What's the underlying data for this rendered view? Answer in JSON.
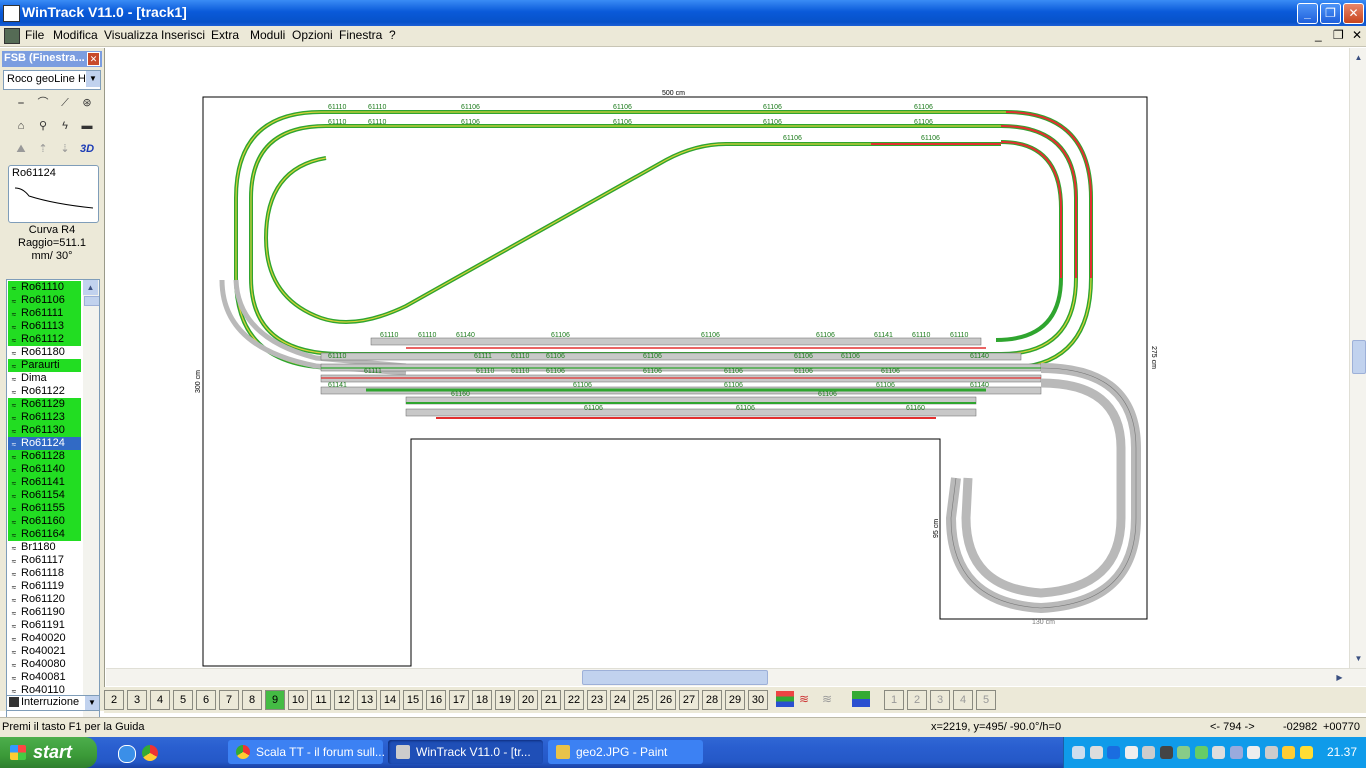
{
  "window": {
    "title": "WinTrack  V11.0 - [track1]",
    "controls": {
      "minimize": "_",
      "maximize": "❐",
      "close": "✕"
    }
  },
  "menu": [
    "File",
    "Modifica",
    "Visualizza",
    "Inserisci",
    "Extra",
    "Moduli",
    "Opzioni",
    "Finestra",
    "?"
  ],
  "mdi_controls": [
    "_",
    "❐",
    "✕"
  ],
  "fsb": {
    "title": "FSB (Finestra...",
    "library": "Roco geoLine H",
    "preview_code": "Ro61124",
    "description": [
      "Curva R4",
      "Raggio=511.1",
      "mm/ 30°"
    ],
    "parts": [
      {
        "label": "Ro61110",
        "hl": "g"
      },
      {
        "label": "Ro61106",
        "hl": "g"
      },
      {
        "label": "Ro61111",
        "hl": "g"
      },
      {
        "label": "Ro61113",
        "hl": "g"
      },
      {
        "label": "Ro61112",
        "hl": "g"
      },
      {
        "label": "Ro61180",
        "hl": ""
      },
      {
        "label": "Paraurti",
        "hl": "g"
      },
      {
        "label": "Dima",
        "hl": ""
      },
      {
        "label": "Ro61122",
        "hl": ""
      },
      {
        "label": "Ro61129",
        "hl": "g"
      },
      {
        "label": "Ro61123",
        "hl": "g"
      },
      {
        "label": "Ro61130",
        "hl": "g"
      },
      {
        "label": "Ro61124",
        "hl": "sel"
      },
      {
        "label": "Ro61128",
        "hl": "g"
      },
      {
        "label": "Ro61140",
        "hl": "g"
      },
      {
        "label": "Ro61141",
        "hl": "g"
      },
      {
        "label": "Ro61154",
        "hl": "g"
      },
      {
        "label": "Ro61155",
        "hl": "g"
      },
      {
        "label": "Ro61160",
        "hl": "g"
      },
      {
        "label": "Ro61164",
        "hl": "g"
      },
      {
        "label": "Br1180",
        "hl": ""
      },
      {
        "label": "Ro61117",
        "hl": ""
      },
      {
        "label": "Ro61118",
        "hl": ""
      },
      {
        "label": "Ro61119",
        "hl": ""
      },
      {
        "label": "Ro61120",
        "hl": ""
      },
      {
        "label": "Ro61190",
        "hl": ""
      },
      {
        "label": "Ro61191",
        "hl": ""
      },
      {
        "label": "Ro40020",
        "hl": ""
      },
      {
        "label": "Ro40021",
        "hl": ""
      },
      {
        "label": "Ro40080",
        "hl": ""
      },
      {
        "label": "Ro40081",
        "hl": ""
      },
      {
        "label": "Ro40110",
        "hl": ""
      }
    ],
    "bottom_select": "Interruzione",
    "tool_3d": "3D"
  },
  "plan": {
    "dim_top": "500 cm",
    "dim_left": "300 cm",
    "dim_right": "275 cm",
    "dim_inner": "95 cm",
    "dim_bottom_small": "130 cm",
    "labels_top1": [
      "61110",
      "61110",
      "61106",
      "61106",
      "61106",
      "61106"
    ],
    "labels_top2": [
      "61110",
      "61110",
      "61106",
      "61106",
      "61106",
      "61106"
    ],
    "labels_top3": [
      "61106",
      "61106"
    ],
    "labels_station1": [
      "61110",
      "61110",
      "61140",
      "61106",
      "61106",
      "61106",
      "61141",
      "61110",
      "61110"
    ],
    "labels_station2": [
      "61110",
      "61111",
      "61110",
      "61106",
      "61106",
      "61106",
      "61106",
      "61140"
    ],
    "labels_station3": [
      "61111",
      "61110",
      "61110",
      "61106",
      "61106",
      "61106",
      "61106",
      "61106"
    ],
    "labels_station4": [
      "61141",
      "61106",
      "61106",
      "61106",
      "61140"
    ],
    "labels_station5": [
      "61160",
      "61106",
      "61106",
      "61106",
      "61160"
    ],
    "colors": {
      "green": "#2fa52f",
      "red": "#e23030",
      "yellow": "#d8d23a",
      "grey": "#c8c8c8",
      "label": "#1a7a1a"
    }
  },
  "pages": {
    "tabs": [
      "2",
      "3",
      "4",
      "5",
      "6",
      "7",
      "8",
      "9",
      "10",
      "11",
      "12",
      "13",
      "14",
      "15",
      "16",
      "17",
      "18",
      "19",
      "20",
      "21",
      "22",
      "23",
      "24",
      "25",
      "26",
      "27",
      "28",
      "29",
      "30"
    ],
    "active": "9",
    "layers": [
      "1",
      "2",
      "3",
      "4",
      "5"
    ]
  },
  "status": {
    "help": "Premi il tasto F1 per la Guida",
    "coords": "x=2219, y=495/ -90.0°/h=0",
    "distance": "<- 794 ->",
    "val1": "-02982",
    "val2": "+00770"
  },
  "taskbar": {
    "start": "start",
    "tasks": [
      "Scala TT - il forum sull...",
      "WinTrack  V11.0 - [tr...",
      "geo2.JPG - Paint"
    ],
    "clock": "21.37"
  }
}
